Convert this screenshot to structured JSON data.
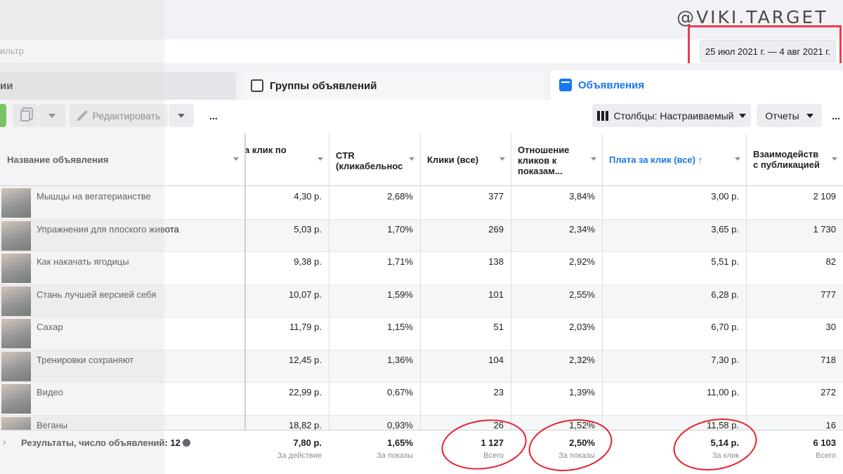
{
  "watermark": "@VIKI.TARGET_",
  "filter": {
    "placeholder": "ильтр"
  },
  "date_range": "25 июл 2021 г. — 4 авг 2021 г.",
  "tabs": [
    {
      "label": "ии"
    },
    {
      "label": "Группы объявлений"
    },
    {
      "label": "Объявления"
    }
  ],
  "toolbar": {
    "edit_label": "Редактировать",
    "more_label": "...",
    "columns_label": "Столбцы: Настраиваемый",
    "reports_label": "Отчеты",
    "more_right_label": "..."
  },
  "columns": [
    {
      "key": "name",
      "label": "Название объявления"
    },
    {
      "key": "cost_per_click",
      "label": "а клик по"
    },
    {
      "key": "ctr",
      "label": "CTR (кликабельнос"
    },
    {
      "key": "clicks",
      "label": "Клики (все)"
    },
    {
      "key": "click_ratio",
      "label": "Отношение кликов к показам..."
    },
    {
      "key": "cpc_all",
      "label": "Плата за клик (все) ↑"
    },
    {
      "key": "engagement",
      "label": "Взаимодейств с публикацией"
    }
  ],
  "rows": [
    {
      "name": "Мышцы на вегатерианстве",
      "cost_per_click": "4,30 р.",
      "ctr": "2,68%",
      "clicks": "377",
      "click_ratio": "3,84%",
      "cpc_all": "3,00 р.",
      "engagement": "2 109"
    },
    {
      "name": "Упражнения для плоского живота",
      "cost_per_click": "5,03 р.",
      "ctr": "1,70%",
      "clicks": "269",
      "click_ratio": "2,34%",
      "cpc_all": "3,65 р.",
      "engagement": "1 730"
    },
    {
      "name": "Как накачать ягодицы",
      "cost_per_click": "9,38 р.",
      "ctr": "1,71%",
      "clicks": "138",
      "click_ratio": "2,92%",
      "cpc_all": "5,51 р.",
      "engagement": "82"
    },
    {
      "name": "Стань лучшей версией себя",
      "cost_per_click": "10,07 р.",
      "ctr": "1,59%",
      "clicks": "101",
      "click_ratio": "2,55%",
      "cpc_all": "6,28 р.",
      "engagement": "777"
    },
    {
      "name": "Сахар",
      "cost_per_click": "11,79 р.",
      "ctr": "1,15%",
      "clicks": "51",
      "click_ratio": "2,03%",
      "cpc_all": "6,70 р.",
      "engagement": "30"
    },
    {
      "name": "Тренировки сохраняют",
      "cost_per_click": "12,45 р.",
      "ctr": "1,36%",
      "clicks": "104",
      "click_ratio": "2,32%",
      "cpc_all": "7,30 р.",
      "engagement": "718"
    },
    {
      "name": "Видео",
      "cost_per_click": "22,99 р.",
      "ctr": "0,67%",
      "clicks": "23",
      "click_ratio": "1,39%",
      "cpc_all": "11,00 р.",
      "engagement": "272"
    },
    {
      "name": "Веганы",
      "cost_per_click": "18,82 р.",
      "ctr": "0,93%",
      "clicks": "26",
      "click_ratio": "1,52%",
      "cpc_all": "11,58 р.",
      "engagement": "16"
    }
  ],
  "summary": {
    "label": "Результаты, число объявлений: 12",
    "cost_per_click": {
      "value": "7,80 р.",
      "sub": "За действие"
    },
    "ctr": {
      "value": "1,65%",
      "sub": "За показы"
    },
    "clicks": {
      "value": "1 127",
      "sub": "Всего"
    },
    "click_ratio": {
      "value": "2,50%",
      "sub": "За показы"
    },
    "cpc_all": {
      "value": "5,14 р.",
      "sub": "За клик"
    },
    "engagement": {
      "value": "6 103",
      "sub": "Всего"
    }
  },
  "colors": {
    "accent": "#1877f2",
    "highlight": "#e8202f",
    "green": "#42b72a"
  }
}
